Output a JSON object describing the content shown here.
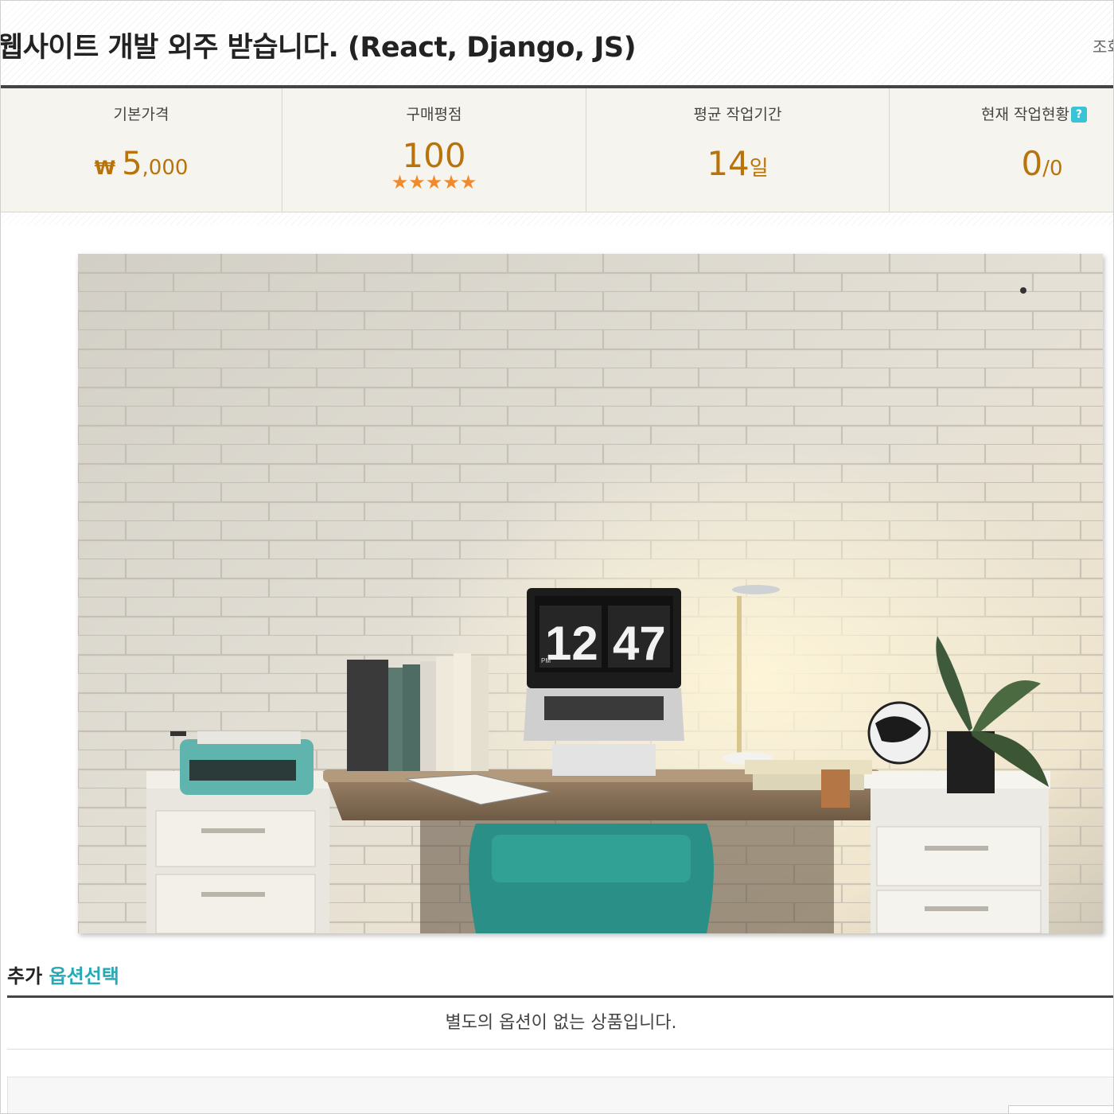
{
  "header": {
    "title": "웹사이트 개발 외주 받습니다. (React, Django, JS)",
    "views_label": "조회"
  },
  "stats": {
    "base_price": {
      "label": "기본가격",
      "currency": "₩",
      "value_main": "5",
      "value_sub": ",000"
    },
    "rating": {
      "label": "구매평점",
      "value": "100",
      "stars": "★★★★★",
      "star_count": 5
    },
    "avg_duration": {
      "label": "평균 작업기간",
      "value_main": "14",
      "value_sub": "일"
    },
    "current_work": {
      "label": "현재 작업현황",
      "help": "?",
      "value_main": "0",
      "value_sub": "/0"
    }
  },
  "hero_image": {
    "description_icon": "desk-photo",
    "clock_hours": "12",
    "clock_minutes": "47",
    "clock_ampm": "PM"
  },
  "options": {
    "title_prefix": "추가",
    "title_accent": "옵션선택",
    "empty_message": "별도의 옵션이 없는 상품입니다."
  },
  "colors": {
    "accent_orange": "#b8740a",
    "star": "#f08a2a",
    "teal": "#27a9b5",
    "help_badge": "#39c3d6"
  }
}
